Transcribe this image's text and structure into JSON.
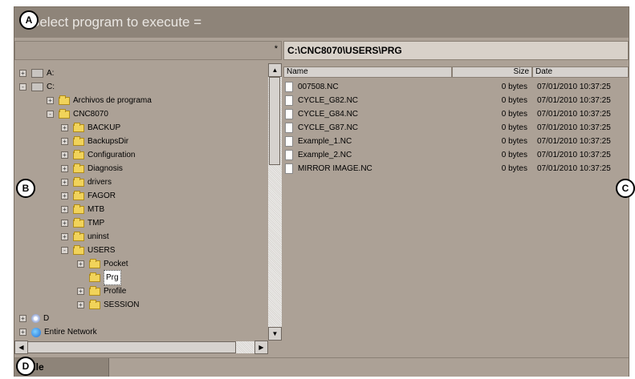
{
  "title": "Select program to execute =",
  "left_path_marker": "*",
  "path": "C:\\CNC8070\\USERS\\PRG",
  "tree": [
    {
      "label": "A:",
      "icon": "floppy-icon",
      "expander": "+"
    },
    {
      "label": "C:",
      "icon": "drive-icon",
      "expander": "-"
    },
    {
      "label": "Archivos de programa",
      "icon": "folder-icon",
      "expander": "+"
    },
    {
      "label": "CNC8070",
      "icon": "folder-icon",
      "expander": "-"
    },
    {
      "label": "BACKUP",
      "icon": "folder-icon",
      "expander": "+"
    },
    {
      "label": "BackupsDir",
      "icon": "folder-icon",
      "expander": "+"
    },
    {
      "label": "Configuration",
      "icon": "folder-icon",
      "expander": "+"
    },
    {
      "label": "Diagnosis",
      "icon": "folder-icon",
      "expander": "+"
    },
    {
      "label": "drivers",
      "icon": "folder-icon",
      "expander": "+"
    },
    {
      "label": "FAGOR",
      "icon": "folder-icon",
      "expander": "+"
    },
    {
      "label": "MTB",
      "icon": "folder-icon",
      "expander": "+"
    },
    {
      "label": "TMP",
      "icon": "folder-icon",
      "expander": "+"
    },
    {
      "label": "uninst",
      "icon": "folder-icon",
      "expander": "+"
    },
    {
      "label": "USERS",
      "icon": "folder-icon",
      "expander": "-"
    },
    {
      "label": "Pocket",
      "icon": "folder-icon",
      "expander": "+"
    },
    {
      "label": "Prg",
      "icon": "folder-open-icon",
      "expander": ""
    },
    {
      "label": "Profile",
      "icon": "folder-icon",
      "expander": "+"
    },
    {
      "label": "SESSION",
      "icon": "folder-icon",
      "expander": "+"
    },
    {
      "label": "D",
      "icon": "cd-icon",
      "expander": "+"
    },
    {
      "label": "Entire Network",
      "icon": "network-icon",
      "expander": "+"
    }
  ],
  "columns": {
    "name": "Name",
    "size": "Size",
    "date": "Date"
  },
  "files": [
    {
      "name": "007508.NC",
      "size": "0 bytes",
      "date": "07/01/2010 10:37:25"
    },
    {
      "name": "CYCLE_G82.NC",
      "size": "0 bytes",
      "date": "07/01/2010 10:37:25"
    },
    {
      "name": "CYCLE_G84.NC",
      "size": "0 bytes",
      "date": "07/01/2010 10:37:25"
    },
    {
      "name": "CYCLE_G87.NC",
      "size": "0 bytes",
      "date": "07/01/2010 10:37:25"
    },
    {
      "name": "Example_1.NC",
      "size": "0 bytes",
      "date": "07/01/2010 10:37:25"
    },
    {
      "name": "Example_2.NC",
      "size": "0 bytes",
      "date": "07/01/2010 10:37:25"
    },
    {
      "name": "MIRROR IMAGE.NC",
      "size": "0 bytes",
      "date": "07/01/2010 10:37:25"
    }
  ],
  "status_tab": "File",
  "callouts": {
    "a": "A",
    "b": "B",
    "c": "C",
    "d": "D"
  }
}
